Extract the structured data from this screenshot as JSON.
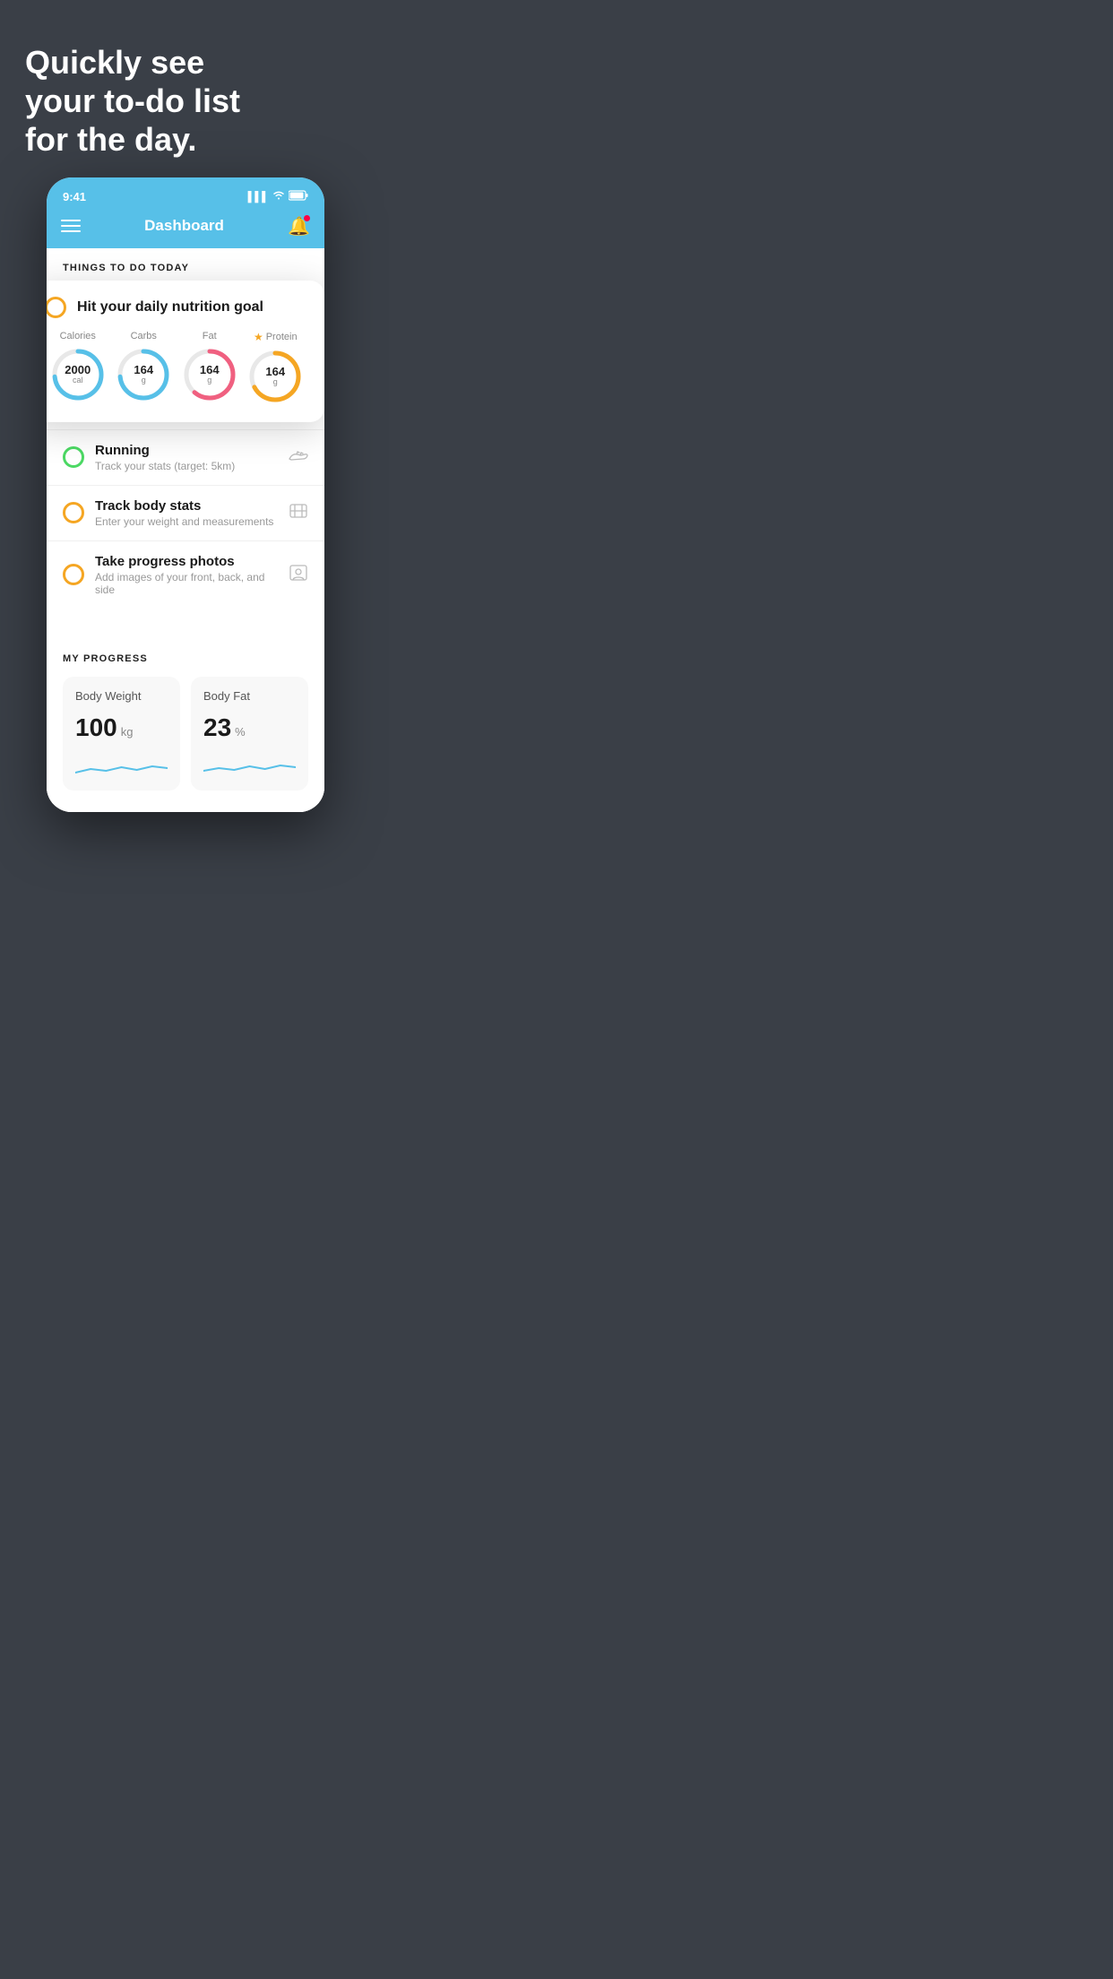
{
  "hero": {
    "line1": "Quickly see",
    "line2": "your to-do list",
    "line3": "for the day."
  },
  "statusBar": {
    "time": "9:41",
    "battery": "▮▮▮",
    "signal": "▌▌▌",
    "wifi": "wifi"
  },
  "navbar": {
    "title": "Dashboard"
  },
  "thingsToDoLabel": "THINGS TO DO TODAY",
  "card": {
    "title": "Hit your daily nutrition goal",
    "nutrients": [
      {
        "label": "Calories",
        "value": "2000",
        "unit": "cal",
        "type": "blue",
        "star": false
      },
      {
        "label": "Carbs",
        "value": "164",
        "unit": "g",
        "type": "blue",
        "star": false
      },
      {
        "label": "Fat",
        "value": "164",
        "unit": "g",
        "type": "pink",
        "star": false
      },
      {
        "label": "Protein",
        "value": "164",
        "unit": "g",
        "type": "yellow",
        "star": true
      }
    ]
  },
  "todoItems": [
    {
      "title": "Running",
      "subtitle": "Track your stats (target: 5km)",
      "icon": "shoe",
      "circleColor": "green"
    },
    {
      "title": "Track body stats",
      "subtitle": "Enter your weight and measurements",
      "icon": "scale",
      "circleColor": "yellow"
    },
    {
      "title": "Take progress photos",
      "subtitle": "Add images of your front, back, and side",
      "icon": "photo",
      "circleColor": "yellow"
    }
  ],
  "progress": {
    "sectionLabel": "MY PROGRESS",
    "cards": [
      {
        "title": "Body Weight",
        "value": "100",
        "unit": "kg"
      },
      {
        "title": "Body Fat",
        "value": "23",
        "unit": "%"
      }
    ]
  }
}
